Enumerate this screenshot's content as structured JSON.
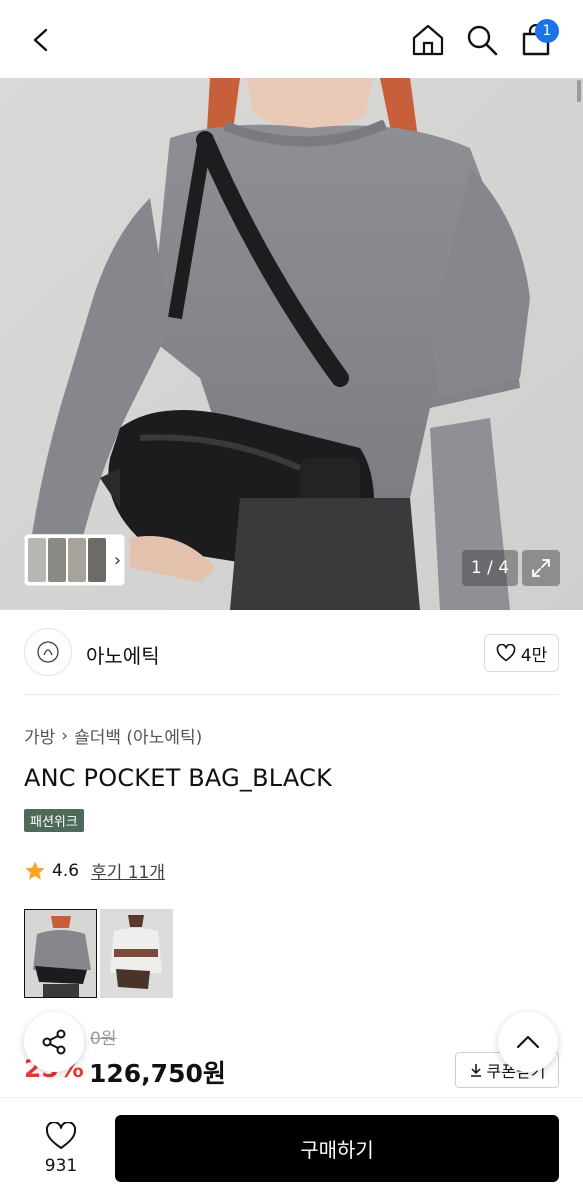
{
  "header": {
    "cart_count": "1",
    "icons": [
      "back-icon",
      "home-icon",
      "search-icon",
      "bag-icon"
    ]
  },
  "gallery": {
    "counter": "1 / 4"
  },
  "brand": {
    "name": "아노에틱",
    "likes": "4만"
  },
  "breadcrumb": {
    "category": "가방",
    "subcategory": "숄더백 (아노에틱)"
  },
  "product": {
    "title": "ANC POCKET BAG_BLACK",
    "badge": "패션위크",
    "rating": "4.6",
    "reviews": "후기 11개",
    "original_price": "0원",
    "discount": "25%",
    "price": "126,750원",
    "coupon_label": "쿠폰받기"
  },
  "bottom": {
    "wish_count": "931",
    "buy_label": "구매하기"
  },
  "colors": {
    "accent_blue": "#1a73e8",
    "badge_green": "#4d6b58",
    "discount_red": "#e53935",
    "star": "#f5a623"
  }
}
